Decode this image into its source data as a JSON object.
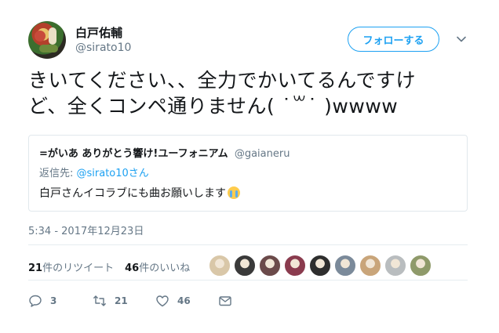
{
  "author": {
    "name": "白戸佑輔",
    "handle": "@sirato10"
  },
  "follow_button": "フォローする",
  "tweet_text": {
    "line1": "きいてください、、全力でかいてるんですけ",
    "line2": "ど、全くコンペ通りません( ˙꒳˙ )wwww"
  },
  "quoted_tweet": {
    "author_name": "=がいあ ありがとう響け!ユーフォニアム",
    "author_handle": "@gaianeru",
    "reply_prefix": "返信先: ",
    "reply_target": "@sirato10さん",
    "text": "白戸さんイコラブにも曲お願いします",
    "emoji": "loudly-crying-face"
  },
  "timestamp": "5:34 - 2017年12月23日",
  "stats": {
    "retweet_count": "21",
    "retweet_label": "件のリツイート",
    "like_count": "46",
    "like_label": "件のいいね"
  },
  "actions": {
    "reply_count": "3",
    "retweet_count": "21",
    "like_count": "46"
  },
  "colors": {
    "accent": "#1da1f2",
    "text": "#14171a",
    "muted": "#657786",
    "border": "#e1e8ed"
  },
  "likers": [
    {
      "name": "liker-1",
      "color": "#d9c7a8"
    },
    {
      "name": "liker-2",
      "color": "#3a3a3a"
    },
    {
      "name": "liker-3",
      "color": "#6b4a4a"
    },
    {
      "name": "liker-4",
      "color": "#8a3b4e"
    },
    {
      "name": "liker-5",
      "color": "#2e2e2e"
    },
    {
      "name": "liker-6",
      "color": "#7b8a9a"
    },
    {
      "name": "liker-7",
      "color": "#c9a57a"
    },
    {
      "name": "liker-8",
      "color": "#b9bdbf"
    },
    {
      "name": "liker-9",
      "color": "#8f9a6a"
    }
  ]
}
